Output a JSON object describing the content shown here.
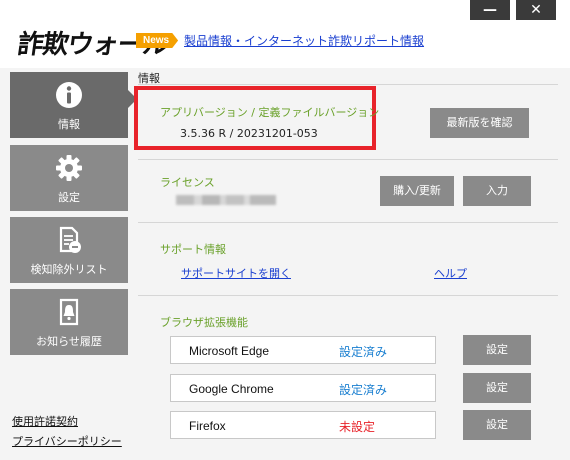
{
  "app": {
    "logo_text": "詐欺ウォール"
  },
  "window_controls": {
    "minimize": "—",
    "close": "✕"
  },
  "news": {
    "badge": "News",
    "link_text": "製品情報・インターネット詐欺リポート情報"
  },
  "sidebar": {
    "items": [
      {
        "label": "情報",
        "icon": "info-icon",
        "active": true
      },
      {
        "label": "設定",
        "icon": "gear-icon",
        "active": false
      },
      {
        "label": "検知除外リスト",
        "icon": "document-minus-icon",
        "active": false
      },
      {
        "label": "お知らせ履歴",
        "icon": "bell-icon",
        "active": false
      }
    ],
    "footer": {
      "terms": "使用許諾契約",
      "privacy": "プライバシーポリシー"
    }
  },
  "main": {
    "section_title": "情報",
    "version": {
      "label": "アプリバージョン / 定義ファイルバージョン",
      "value": "3.5.36 R / 20231201-053",
      "check_button": "最新版を確認"
    },
    "license": {
      "label": "ライセンス",
      "buy_button": "購入/更新",
      "enter_button": "入力"
    },
    "support": {
      "label": "サポート情報",
      "open_site_link": "サポートサイトを開く",
      "help_link": "ヘルプ"
    },
    "browser_extensions": {
      "label": "ブラウザ拡張機能",
      "items": [
        {
          "name": "Microsoft Edge",
          "status": "設定済み",
          "status_color": "#1a7fd0",
          "button": "設定"
        },
        {
          "name": "Google Chrome",
          "status": "設定済み",
          "status_color": "#1a7fd0",
          "button": "設定"
        },
        {
          "name": "Firefox",
          "status": "未設定",
          "status_color": "#e8232a",
          "button": "設定"
        }
      ]
    }
  },
  "colors": {
    "accent_red": "#e8232a",
    "label_green": "#6aa12a",
    "link_blue": "#1a3fd0",
    "news_orange": "#f5a000"
  }
}
